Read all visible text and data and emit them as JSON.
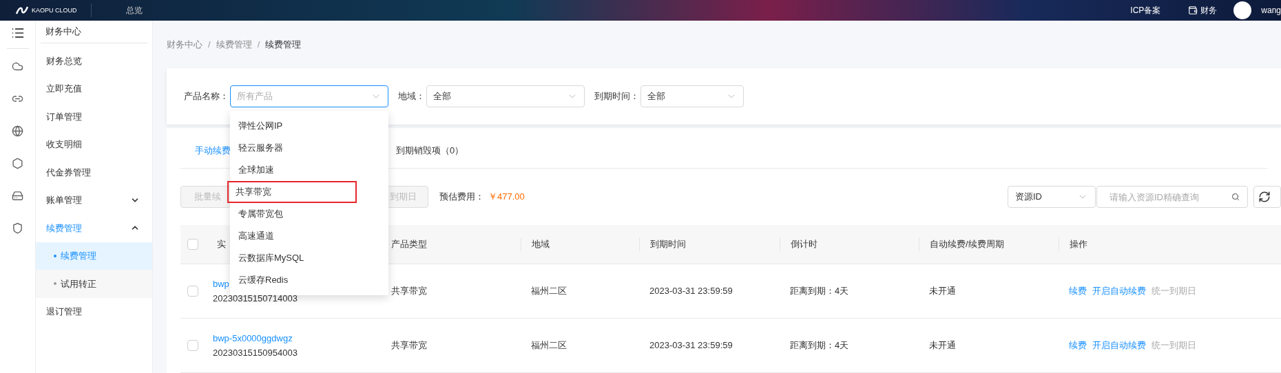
{
  "topbar": {
    "logo_text": "KAOPU CLOUD",
    "nav": [
      "总览"
    ],
    "links": [
      "ICP备案",
      "财务"
    ],
    "user": "wang"
  },
  "sidebar": {
    "title": "财务中心",
    "items": [
      {
        "label": "财务总览",
        "selected": false
      },
      {
        "label": "立即充值",
        "selected": false
      },
      {
        "label": "订单管理",
        "selected": false
      },
      {
        "label": "收支明细",
        "selected": false
      },
      {
        "label": "代金券管理",
        "selected": false
      },
      {
        "label": "账单管理",
        "selected": false,
        "expanded": false
      },
      {
        "label": "续费管理",
        "selected": true,
        "expanded": true,
        "children": [
          {
            "label": "续费管理",
            "selected": true
          },
          {
            "label": "试用转正",
            "selected": false
          }
        ]
      },
      {
        "label": "退订管理",
        "selected": false
      }
    ]
  },
  "breadcrumb": {
    "separator": "/",
    "items": [
      "财务中心",
      "续费管理",
      "续费管理"
    ]
  },
  "filters": [
    {
      "label": "产品名称：",
      "placeholder": "所有产品",
      "open": true
    },
    {
      "label": "地域：",
      "value": "全部",
      "open": false
    },
    {
      "label": "到期时间：",
      "value": "全部",
      "open": false
    }
  ],
  "dropdown": {
    "options": [
      {
        "label": "弹性公网IP",
        "annotated": false
      },
      {
        "label": "轻云服务器",
        "annotated": false
      },
      {
        "label": "全球加速",
        "annotated": false
      },
      {
        "label": "共享带宽",
        "annotated": true
      },
      {
        "label": "专属带宽包",
        "annotated": false
      },
      {
        "label": "高速通道",
        "annotated": false
      },
      {
        "label": "云数据库MySQL",
        "annotated": false
      },
      {
        "label": "云缓存Redis",
        "annotated": false
      }
    ]
  },
  "tabs": [
    {
      "label": "手动续费",
      "selected": true
    },
    {
      "label": "到期销毁项（0）",
      "selected": false
    }
  ],
  "toolbar": {
    "buttons": [
      {
        "label": "批量续",
        "disabled": true
      },
      {
        "label": "到期日",
        "disabled": true
      }
    ],
    "estimate_label": "预估费用：",
    "estimate_value": "￥477.00"
  },
  "search": {
    "type_select": "资源ID",
    "placeholder": "请输入资源ID精确查询"
  },
  "table": {
    "header_checked": false,
    "columns": [
      "实",
      "产品类型",
      "地域",
      "到期时间",
      "倒计时",
      "自动续费/续费周期",
      "操作"
    ],
    "rows": [
      {
        "checked": false,
        "instance_id": "bwp",
        "instance_number": "20230315150714003",
        "type": "共享带宽",
        "region": "福州二区",
        "expiry": "2023-03-31 23:59:59",
        "countdown": "距离到期：4天",
        "auto_renew": "未开通",
        "actions": [
          {
            "label": "续费",
            "disabled": false
          },
          {
            "label": "开启自动续费",
            "disabled": false
          },
          {
            "label": "统一到期日",
            "disabled": true
          }
        ]
      },
      {
        "checked": false,
        "instance_id": "bwp-5x0000ggdwgz",
        "instance_number": "20230315150954003",
        "type": "共享带宽",
        "region": "福州二区",
        "expiry": "2023-03-31 23:59:59",
        "countdown": "距离到期：4天",
        "auto_renew": "未开通",
        "actions": [
          {
            "label": "续费",
            "disabled": false
          },
          {
            "label": "开启自动续费",
            "disabled": false
          },
          {
            "label": "统一到期日",
            "disabled": true
          }
        ]
      }
    ]
  }
}
